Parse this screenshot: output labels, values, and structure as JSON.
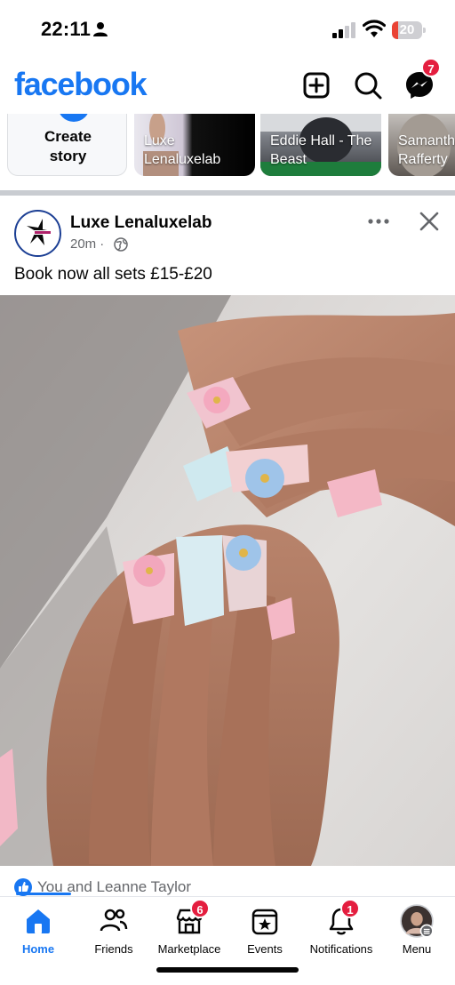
{
  "status_bar": {
    "time": "22:11",
    "battery": "20",
    "battery_level": 0.2,
    "icons": [
      "person-icon",
      "signal-icon",
      "wifi-icon",
      "battery-icon"
    ]
  },
  "header": {
    "logo": "facebook",
    "brand_color": "#1877f2",
    "buttons": [
      "create-icon",
      "search-icon",
      "messenger-icon"
    ],
    "messenger_badge": "7"
  },
  "stories": {
    "create_label": "Create story",
    "items": [
      {
        "name": "Luxe Lenaluxelab"
      },
      {
        "name": "Eddie Hall - The Beast"
      },
      {
        "name": "Samantha Rafferty"
      }
    ]
  },
  "post": {
    "author": "Luxe Lenaluxelab",
    "time": "20m",
    "privacy": "globe-icon",
    "text": "Book now all sets £15-£20",
    "reactions_text": "You and Leanne Taylor"
  },
  "tabs": [
    {
      "label": "Home",
      "icon": "home-icon",
      "active": true
    },
    {
      "label": "Friends",
      "icon": "friends-icon"
    },
    {
      "label": "Marketplace",
      "icon": "marketplace-icon",
      "badge": "6"
    },
    {
      "label": "Events",
      "icon": "events-icon"
    },
    {
      "label": "Notifications",
      "icon": "bell-icon",
      "badge": "1"
    },
    {
      "label": "Menu",
      "icon": "profile-avatar"
    }
  ],
  "colors": {
    "accent": "#1877f2",
    "badge": "#e41e3f",
    "secondary_text": "#65676b"
  }
}
